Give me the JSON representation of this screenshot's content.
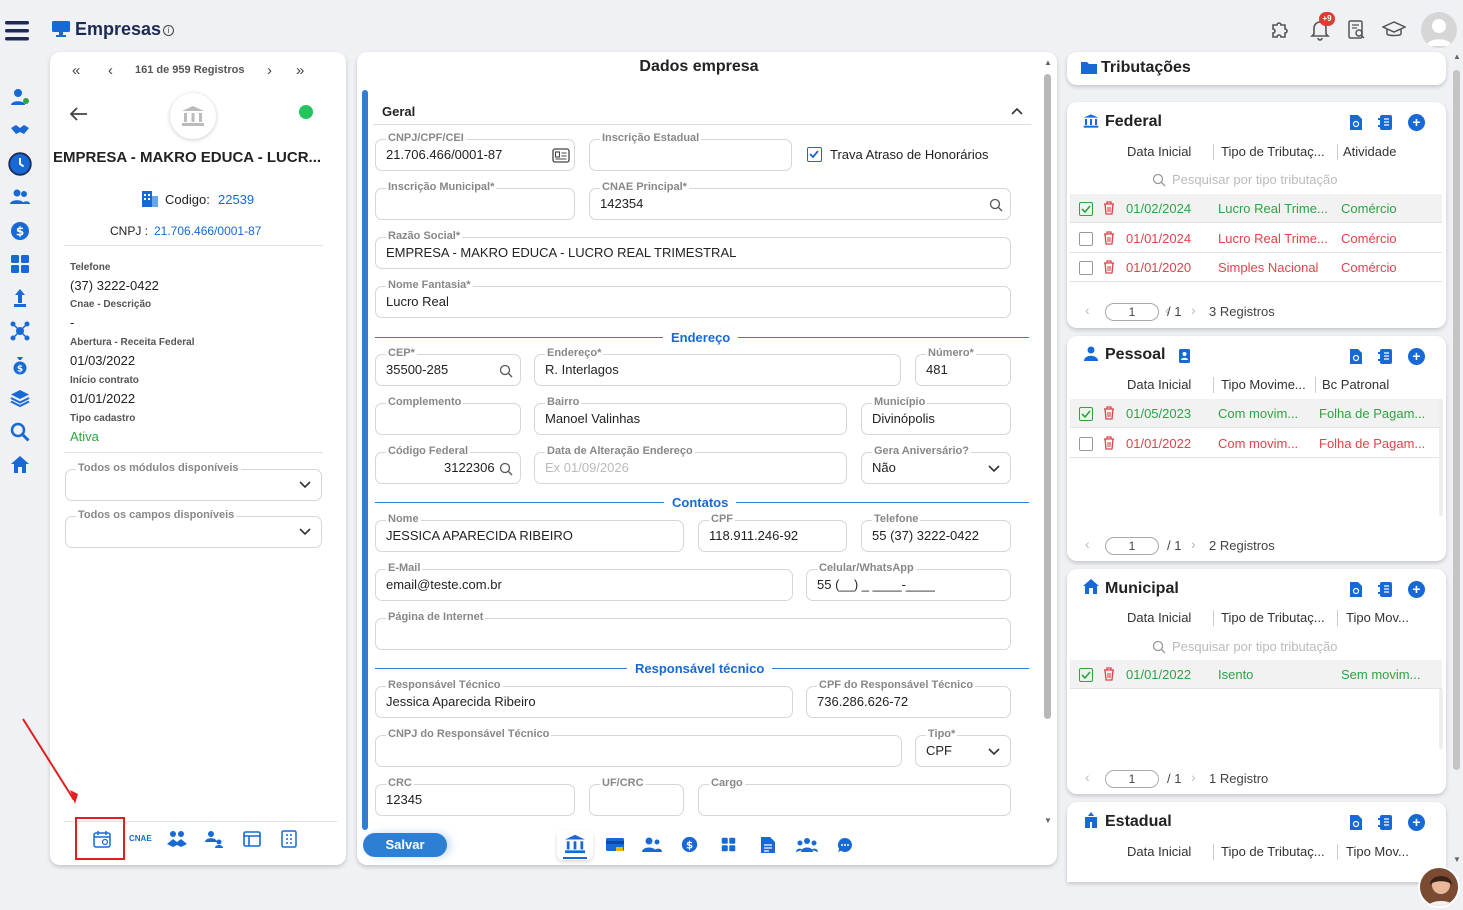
{
  "header": {
    "title": "Empresas",
    "notification_count": "+9"
  },
  "record_nav": {
    "counter": "161 de 959 Registros"
  },
  "company": {
    "name": "EMPRESA - MAKRO EDUCA - LUCR...",
    "code_label": "Codigo:",
    "code": "22539",
    "cnpj_label": "CNPJ :",
    "cnpj": "21.706.466/0001-87",
    "status_color": "#22c55e",
    "fields": [
      {
        "label": "Telefone",
        "value": "(37) 3222-0422"
      },
      {
        "label": "Cnae - Descrição",
        "value": "-"
      },
      {
        "label": "Abertura - Receita Federal",
        "value": "01/03/2022"
      },
      {
        "label": "Início contrato",
        "value": "01/01/2022"
      },
      {
        "label": "Tipo cadastro",
        "value": "Ativa"
      }
    ],
    "modules_select": "Todos os módulos disponíveis",
    "fields_select": "Todos os campos disponíveis",
    "bottom_tab_cnae": "CNAE"
  },
  "form": {
    "title": "Dados empresa",
    "section_geral": "Geral",
    "cnpj": {
      "label": "CNPJ/CPF/CEI",
      "value": "21.706.466/0001-87"
    },
    "inscricao_estadual": {
      "label": "Inscrição Estadual",
      "value": ""
    },
    "trava": {
      "label": "Trava Atraso de Honorários",
      "checked": true
    },
    "inscricao_municipal": {
      "label": "Inscrição Municipal*",
      "value": ""
    },
    "cnae": {
      "label": "CNAE Principal*",
      "value": "142354"
    },
    "razao": {
      "label": "Razão Social*",
      "value": "EMPRESA - MAKRO EDUCA - LUCRO REAL TRIMESTRAL"
    },
    "fantasia": {
      "label": "Nome Fantasia*",
      "value": "Lucro Real"
    },
    "section_endereco": "Endereço",
    "cep": {
      "label": "CEP*",
      "value": "35500-285"
    },
    "endereco": {
      "label": "Endereço*",
      "value": "R. Interlagos"
    },
    "numero": {
      "label": "Número*",
      "value": "481"
    },
    "complemento": {
      "label": "Complemento",
      "value": ""
    },
    "bairro": {
      "label": "Bairro",
      "value": "Manoel Valinhas"
    },
    "municipio": {
      "label": "Município",
      "value": "Divinópolis"
    },
    "codigo_federal": {
      "label": "Código Federal",
      "value": "3122306"
    },
    "data_alteracao": {
      "label": "Data de Alteração Endereço",
      "placeholder": "Ex 01/09/2026"
    },
    "aniversario": {
      "label": "Gera Aniversário?",
      "value": "Não"
    },
    "section_contatos": "Contatos",
    "nome": {
      "label": "Nome",
      "value": "JESSICA APARECIDA RIBEIRO"
    },
    "cpf": {
      "label": "CPF",
      "value": "118.911.246-92"
    },
    "telefone": {
      "label": "Telefone",
      "value": "55 (37) 3222-0422"
    },
    "email": {
      "label": "E-Mail",
      "value": "email@teste.com.br"
    },
    "celular": {
      "label": "Celular/WhatsApp",
      "value": "55 (__) _ ____-____"
    },
    "pagina": {
      "label": "Página de Internet",
      "value": ""
    },
    "section_responsavel": "Responsável técnico",
    "resp": {
      "label": "Responsável Técnico",
      "value": "Jessica Aparecida Ribeiro"
    },
    "cpf_resp": {
      "label": "CPF do Responsável Técnico",
      "value": "736.286.626-72"
    },
    "cnpj_resp": {
      "label": "CNPJ do Responsável Técnico",
      "value": ""
    },
    "tipo": {
      "label": "Tipo*",
      "value": "CPF"
    },
    "crc": {
      "label": "CRC",
      "value": "12345"
    },
    "uf_crc": {
      "label": "UF/CRC",
      "value": ""
    },
    "cargo": {
      "label": "Cargo",
      "value": ""
    },
    "save": "Salvar"
  },
  "tributacoes": {
    "title": "Tributações",
    "federal": {
      "title": "Federal",
      "cols": [
        "Data Inicial",
        "Tipo de Tributaç...",
        "Atividade"
      ],
      "search": "Pesquisar por tipo tributação",
      "rows": [
        {
          "date": "01/02/2024",
          "tipo": "Lucro Real Trime...",
          "extra": "Comércio",
          "active": true
        },
        {
          "date": "01/01/2024",
          "tipo": "Lucro Real Trime...",
          "extra": "Comércio",
          "active": false
        },
        {
          "date": "01/01/2020",
          "tipo": "Simples Nacional",
          "extra": "Comércio",
          "active": false
        }
      ],
      "page": "1",
      "of": "/ 1",
      "count": "3 Registros"
    },
    "pessoal": {
      "title": "Pessoal",
      "cols": [
        "Data Inicial",
        "Tipo Movime...",
        "Bc Patronal"
      ],
      "rows": [
        {
          "date": "01/05/2023",
          "tipo": "Com movim...",
          "extra": "Folha de Pagam...",
          "active": true
        },
        {
          "date": "01/01/2022",
          "tipo": "Com movim...",
          "extra": "Folha de Pagam...",
          "active": false
        }
      ],
      "page": "1",
      "of": "/ 1",
      "count": "2 Registros"
    },
    "municipal": {
      "title": "Municipal",
      "cols": [
        "Data Inicial",
        "Tipo de Tributaç...",
        "Tipo Mov..."
      ],
      "search": "Pesquisar por tipo tributação",
      "rows": [
        {
          "date": "01/01/2022",
          "tipo": "Isento",
          "extra": "Sem movim...",
          "active": true
        }
      ],
      "page": "1",
      "of": "/ 1",
      "count": "1 Registro"
    },
    "estadual": {
      "title": "Estadual",
      "cols": [
        "Data Inicial",
        "Tipo de Tributaç...",
        "Tipo Mov..."
      ]
    }
  },
  "colors": {
    "accent": "#1769d6",
    "active_green": "#2ea344",
    "inactive_red": "#e0434a",
    "highlight": "#e02020"
  }
}
